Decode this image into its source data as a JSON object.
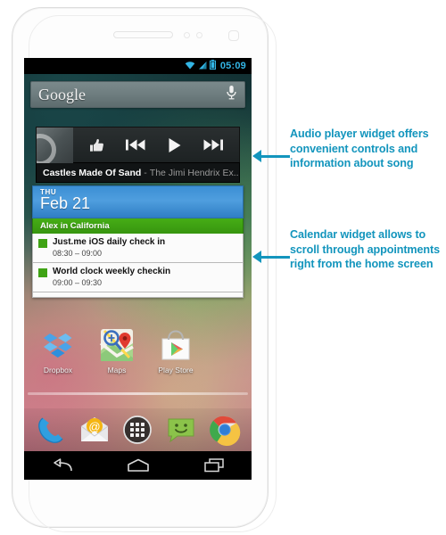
{
  "device": {
    "name": "android-phone-mockup",
    "body_color": "#fdfdfd"
  },
  "status_bar": {
    "time": "05:09",
    "time_color": "#33b5e5",
    "icons": [
      "wifi-icon",
      "cellular-signal-icon",
      "battery-icon"
    ]
  },
  "search_widget": {
    "label": "Google",
    "mic_icon": "microphone-icon"
  },
  "music_widget": {
    "buttons": [
      {
        "name": "thumbs-up-button",
        "icon": "thumbs-up-icon"
      },
      {
        "name": "previous-track-button",
        "icon": "previous-icon"
      },
      {
        "name": "play-button",
        "icon": "play-icon"
      },
      {
        "name": "next-track-button",
        "icon": "next-icon"
      }
    ],
    "track_title": "Castles Made Of Sand",
    "separator": "-",
    "track_artist": "The Jimi Hendrix Ex.."
  },
  "calendar_widget": {
    "weekday": "THU",
    "date": "Feb 21",
    "header_color": "#4f9ede",
    "all_day_event": "Alex in California",
    "all_day_color": "#46ad16",
    "events": [
      {
        "title": "Just.me iOS daily check in",
        "time": "08:30 – 09:00",
        "color": "#3fa314"
      },
      {
        "title": "World clock weekly checkin",
        "time": "09:00 – 09:30",
        "color": "#3fa314"
      }
    ]
  },
  "apps": [
    {
      "label": "Dropbox",
      "icon": "dropbox-icon"
    },
    {
      "label": "Maps",
      "icon": "google-maps-icon"
    },
    {
      "label": "Play Store",
      "icon": "play-store-icon"
    }
  ],
  "dock": [
    {
      "name": "phone-app",
      "icon": "phone-icon"
    },
    {
      "name": "email-app",
      "icon": "email-icon"
    },
    {
      "name": "app-drawer",
      "icon": "app-drawer-icon"
    },
    {
      "name": "messaging-app",
      "icon": "messaging-icon"
    },
    {
      "name": "chrome-app",
      "icon": "chrome-icon"
    }
  ],
  "nav_bar": [
    {
      "name": "back-button",
      "icon": "back-arrow-icon"
    },
    {
      "name": "home-button",
      "icon": "home-icon"
    },
    {
      "name": "recents-button",
      "icon": "recent-apps-icon"
    }
  ],
  "annotations": [
    {
      "id": "audio",
      "text": "Audio player widget offers convenient controls and information about song",
      "color": "#1395bd"
    },
    {
      "id": "calendar",
      "text": "Calendar widget allows to scroll through appointments right from the home screen",
      "color": "#1395bd"
    }
  ]
}
